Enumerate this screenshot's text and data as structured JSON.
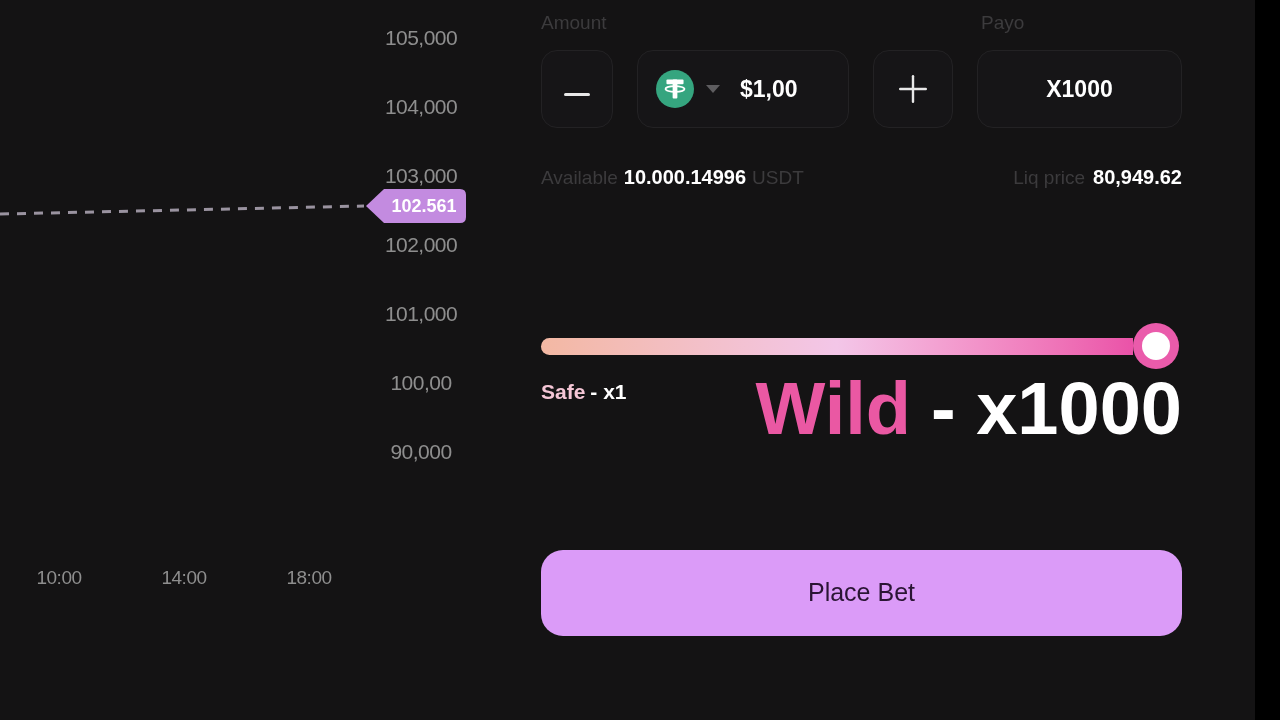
{
  "chart": {
    "y_axis_labels": [
      "105,000",
      "104,000",
      "103,000",
      "102,000",
      "101,000",
      "100,00",
      "90,000"
    ],
    "x_axis_labels": [
      "10:00",
      "14:00",
      "18:00"
    ],
    "price_tag": "102.561"
  },
  "bet_form": {
    "amount_label": "Amount",
    "payout_label": "Payo",
    "amount_field": {
      "value": "$1,00"
    },
    "payout_field": {
      "value": "X1000"
    },
    "available": {
      "label": "Available",
      "amount": "10.000.14996",
      "currency": "USDT"
    },
    "liq_price": {
      "label": "Liq price",
      "value": "80,949.62"
    },
    "risk_slider": {
      "level": 1,
      "min_label": "Safe",
      "min_multiplier": "- x1",
      "current_label": "Wild",
      "current_multiplier": "- x1000"
    },
    "place_bet_button": {
      "label": "Place Bet"
    }
  }
}
